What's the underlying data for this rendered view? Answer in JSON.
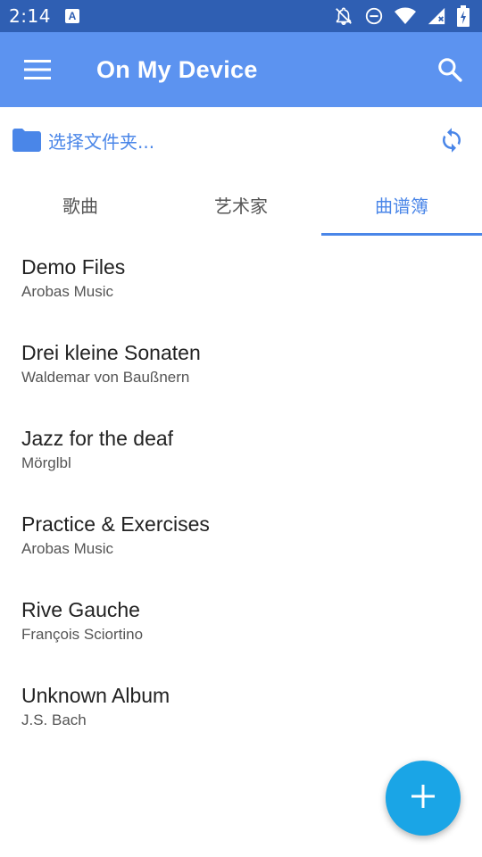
{
  "status_bar": {
    "time": "2:14",
    "icons": [
      "app-notification-icon",
      "notifications-off-icon",
      "do-not-disturb-icon",
      "wifi-icon",
      "signal-icon",
      "battery-icon"
    ]
  },
  "app_bar": {
    "title": "On My Device",
    "background": "#5c93f0"
  },
  "folder": {
    "label": "选择文件夹..."
  },
  "tabs": [
    {
      "label": "歌曲",
      "active": false
    },
    {
      "label": "艺术家",
      "active": false
    },
    {
      "label": "曲谱簿",
      "active": true
    }
  ],
  "items": [
    {
      "title": "Demo Files",
      "subtitle": "Arobas Music"
    },
    {
      "title": "Drei kleine Sonaten",
      "subtitle": "Waldemar von Baußnern"
    },
    {
      "title": "Jazz for the deaf",
      "subtitle": "Mörglbl"
    },
    {
      "title": "Practice & Exercises",
      "subtitle": "Arobas Music"
    },
    {
      "title": "Rive Gauche",
      "subtitle": "François Sciortino"
    },
    {
      "title": "Unknown Album",
      "subtitle": "J.S. Bach"
    }
  ],
  "colors": {
    "accent": "#4a86e8",
    "fab": "#1aa5e6",
    "status_bar": "#2f5fb3"
  }
}
